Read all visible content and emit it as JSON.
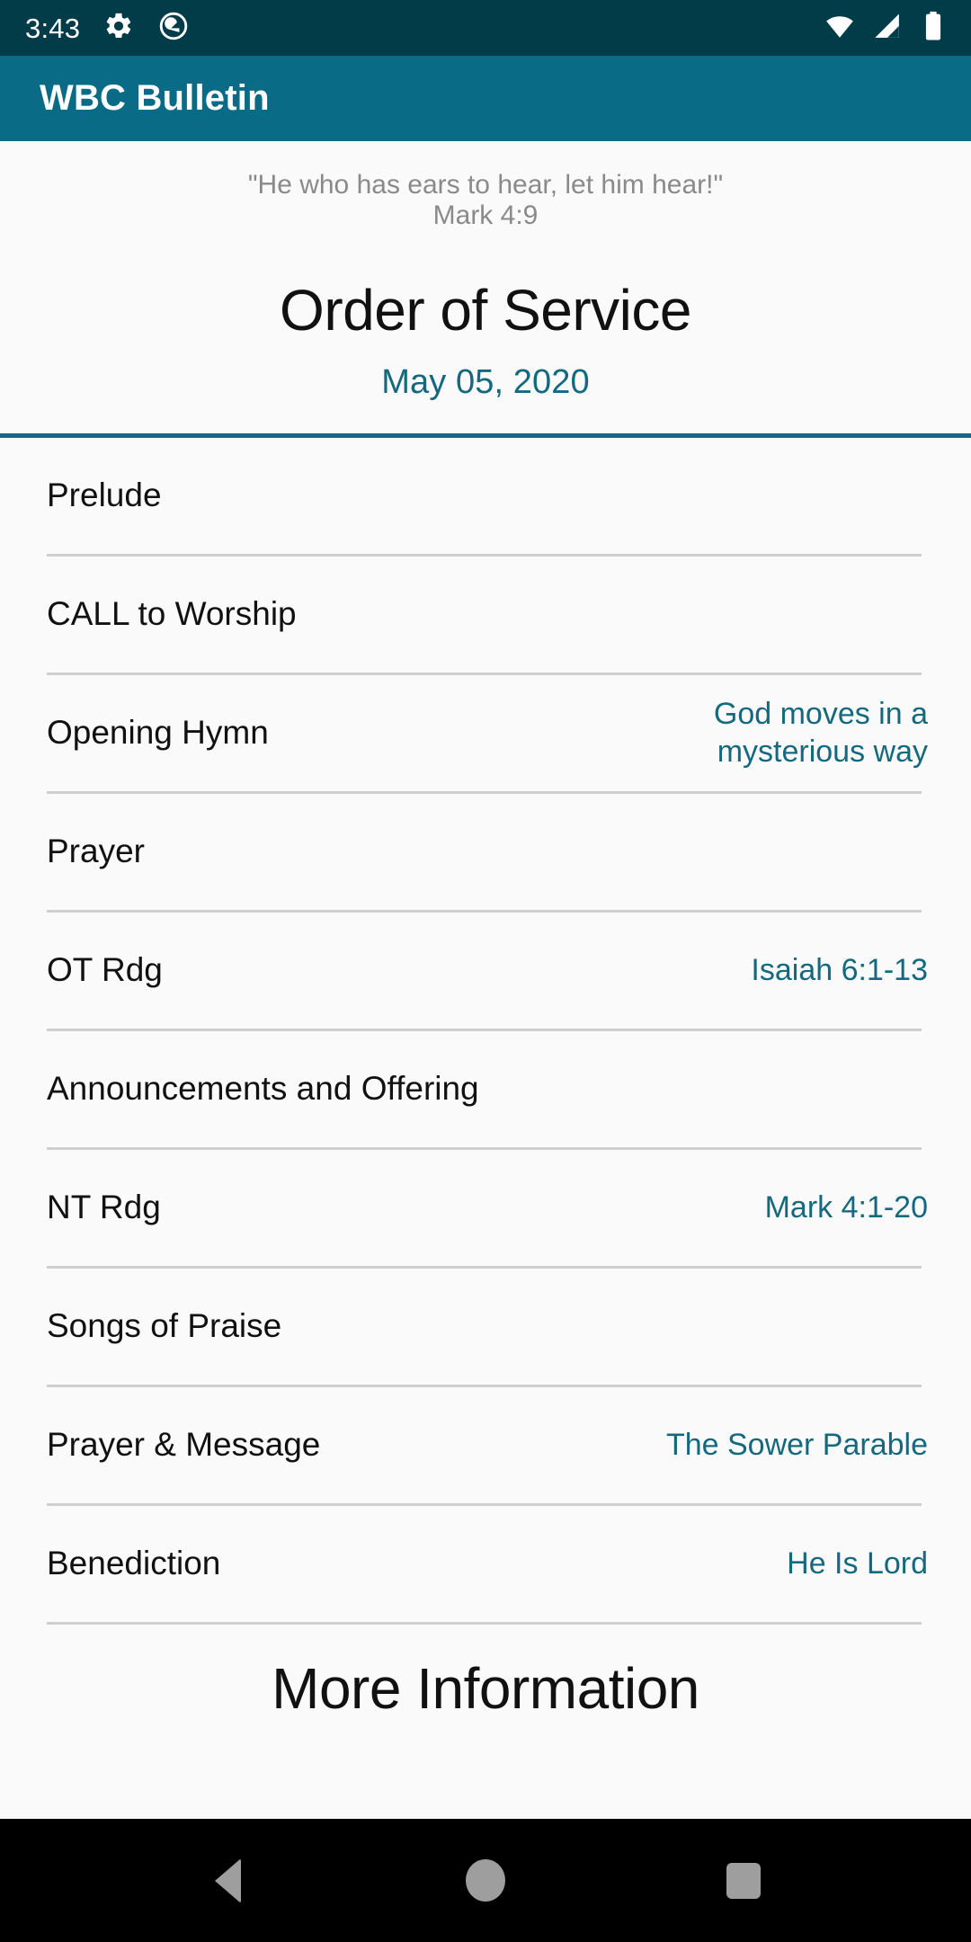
{
  "status_bar": {
    "clock": "3:43",
    "icons_left": [
      "gear-icon",
      "android-q-icon"
    ],
    "icons_right": [
      "wifi-icon",
      "cell-signal-icon",
      "battery-icon"
    ],
    "background": "#033c49"
  },
  "app_bar": {
    "title": "WBC Bulletin",
    "background": "#0a6b86"
  },
  "header": {
    "verse_text": "\"He who has ears to hear, let him hear!\"",
    "verse_reference": "Mark 4:9",
    "page_title": "Order of Service",
    "date": "May 05, 2020",
    "accent_color": "#15697f"
  },
  "service_list": {
    "items": [
      {
        "label": "Prelude",
        "value": ""
      },
      {
        "label": "CALL to Worship",
        "value": ""
      },
      {
        "label": "Opening Hymn",
        "value": "God moves in a mysterious way"
      },
      {
        "label": "Prayer",
        "value": ""
      },
      {
        "label": "OT Rdg",
        "value": "Isaiah 6:1-13"
      },
      {
        "label": "Announcements and Offering",
        "value": ""
      },
      {
        "label": "NT Rdg",
        "value": "Mark 4:1-20"
      },
      {
        "label": "Songs of Praise",
        "value": ""
      },
      {
        "label": "Prayer & Message",
        "value": "The Sower Parable"
      },
      {
        "label": "Benediction",
        "value": "He Is Lord"
      }
    ]
  },
  "more_information": {
    "title": "More Information"
  },
  "nav_bar": {
    "back_label": "Back",
    "home_label": "Home",
    "recents_label": "Recents"
  }
}
